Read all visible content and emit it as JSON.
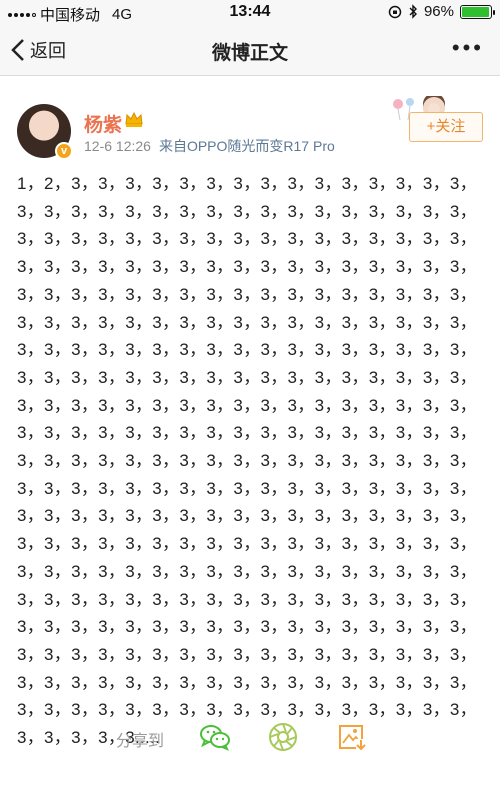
{
  "status_bar": {
    "carrier": "中国移动",
    "network": "4G",
    "time": "13:44",
    "battery_percent_label": "96%",
    "battery_level": 0.96
  },
  "nav": {
    "back_label": "返回",
    "title": "微博正文",
    "more_label": "•••"
  },
  "post": {
    "author": "杨紫",
    "date": "12-6 12:26",
    "source": "来自OPPO随光而变R17 Pro",
    "follow_label": "+关注",
    "text": "1，2，3，3，3，3，3，3，3，3，3，3，3，3，3，3，3，3，3，3，3，3，3，3，3，3，3，3，3，3，3，3，3，3，3，3，3，3，3，3，3，3，3，3，3，3，3，3，3，3，3，3，3，3，3，3，3，3，3，3，3，3，3，3，3，3，3，3，3，3，3，3，3，3，3，3，3，3，3，3，3，3，3，3，3，3，3，3，3，3，3，3，3，3，3，3，3，3，3，3，3，3，3，3，3，3，3，3，3，3，3，3，3，3，3，3，3，3，3，3，3，3，3，3，3，3，3，3，3，3，3，3，3，3，3，3，3，3，3，3，3，3，3，3，3，3，3，3，3，3，3，3，3，3，3，3，3，3，3，3，3，3，3，3，3，3，3，3，3，3，3，3，3，3，3，3，3，3，3，3，3，3，3，3，3，3，3，3，3，3，3，3，3，3，3，3，3，3，3，3，3，3，3，3，3，3，3，3，3，3，3，3，3，3，3，3，3，3，3，3，3，3，3，3，3，3，3，3，3，3，3，3，3，3，3，3，3，3，3，3，3，3，3，3，3，3，3，3，3，3，3，3，3，3，3，3，3，3，3，3，3，3，3，3，3，3，3，3，3，3，3，3，3，3，3，3，3，3，3，3，3，3，3，3，3，3，3，3，3，3，3，3，3，3，3，3，3，3，3，3，3，3，3，3，3，3，3，3，3，3，3，3，3，3，3，3，3，3，3，3，3，3，3，3，3，3，3，3，3，3，3，3，3，3，3，3，3，3，3，3，3，3，3，3，3....."
  },
  "share": {
    "label": "分享到",
    "icons": [
      "wechat-icon",
      "moments-icon",
      "save-image-icon"
    ]
  },
  "colors": {
    "accent_orange": "#eb7350",
    "follow_text": "#e8862b",
    "source_blue": "#5d7895",
    "wechat_green": "#4cbf3a",
    "moments_green": "#a7c957",
    "save_orange": "#f2a33a"
  }
}
